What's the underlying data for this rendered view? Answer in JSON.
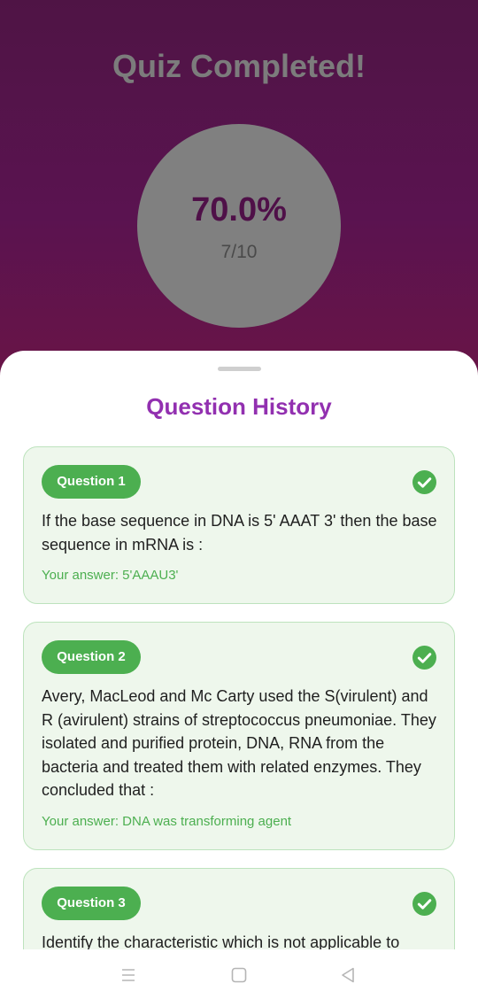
{
  "header": {
    "title": "Quiz Completed!",
    "score_percent": "70.0%",
    "score_fraction": "7/10"
  },
  "history": {
    "title": "Question History",
    "questions": [
      {
        "label": "Question 1",
        "text": "If the base sequence in DNA is 5' AAAT 3' then the base sequence in mRNA is :",
        "answer": "Your answer: 5'AAAU3'",
        "correct": true
      },
      {
        "label": "Question 2",
        "text": "Avery, MacLeod and Mc Carty used the S(virulent) and R (avirulent) strains of streptococcus pneumoniae. They isolated and purified protein, DNA, RNA from the bacteria and treated them with related enzymes. They concluded that :",
        "answer": "Your answer: DNA was transforming agent",
        "correct": true
      },
      {
        "label": "Question 3",
        "text": "Identify the characteristic which is not applicable to",
        "answer": "",
        "correct": true
      }
    ]
  },
  "navbar": {
    "icons": [
      "menu-icon",
      "home-icon",
      "back-icon"
    ]
  },
  "colors": {
    "accent": "#9230b0",
    "correct": "#4caf50",
    "hero_bg": "#55134b"
  }
}
